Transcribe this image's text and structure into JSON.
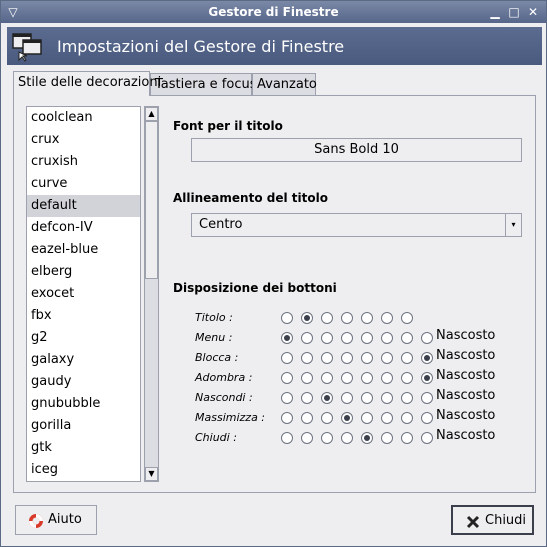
{
  "window": {
    "title": "Gestore di Finestre",
    "menu_icon": "chevron-down-icon",
    "controls": [
      "minimize-icon",
      "maximize-icon",
      "close-icon"
    ]
  },
  "banner": {
    "title": "Impostazioni del Gestore di Finestre",
    "icon": "window-manager-icon"
  },
  "tabs": [
    {
      "label": "Stile delle decorazioni",
      "active": true
    },
    {
      "label": "Tastiera e focus",
      "active": false
    },
    {
      "label": "Avanzato",
      "active": false
    }
  ],
  "themes": {
    "items": [
      "coolclean",
      "crux",
      "cruxish",
      "curve",
      "default",
      "defcon-IV",
      "eazel-blue",
      "elberg",
      "exocet",
      "fbx",
      "g2",
      "galaxy",
      "gaudy",
      "gnububble",
      "gorilla",
      "gtk",
      "iceg"
    ],
    "selected": "default"
  },
  "font_section": {
    "label": "Font per il titolo",
    "value": "Sans Bold 10"
  },
  "alignment_section": {
    "label": "Allineamento del titolo",
    "value": "Centro"
  },
  "buttons_section": {
    "label": "Disposizione dei bottoni",
    "hidden_label": "Nascosto",
    "rows": [
      {
        "label": "Titolo :",
        "selected": 1,
        "has_hidden": false
      },
      {
        "label": "Menu :",
        "selected": 0,
        "has_hidden": true
      },
      {
        "label": "Blocca :",
        "selected": 7,
        "has_hidden": true
      },
      {
        "label": "Adombra :",
        "selected": 7,
        "has_hidden": true
      },
      {
        "label": "Nascondi :",
        "selected": 2,
        "has_hidden": true
      },
      {
        "label": "Massimizza :",
        "selected": 3,
        "has_hidden": true
      },
      {
        "label": "Chiudi :",
        "selected": 4,
        "has_hidden": true
      }
    ]
  },
  "footer": {
    "help_label": "Aiuto",
    "help_icon": "lifebuoy-icon",
    "close_label": "Chiudi",
    "close_icon": "close-icon"
  }
}
